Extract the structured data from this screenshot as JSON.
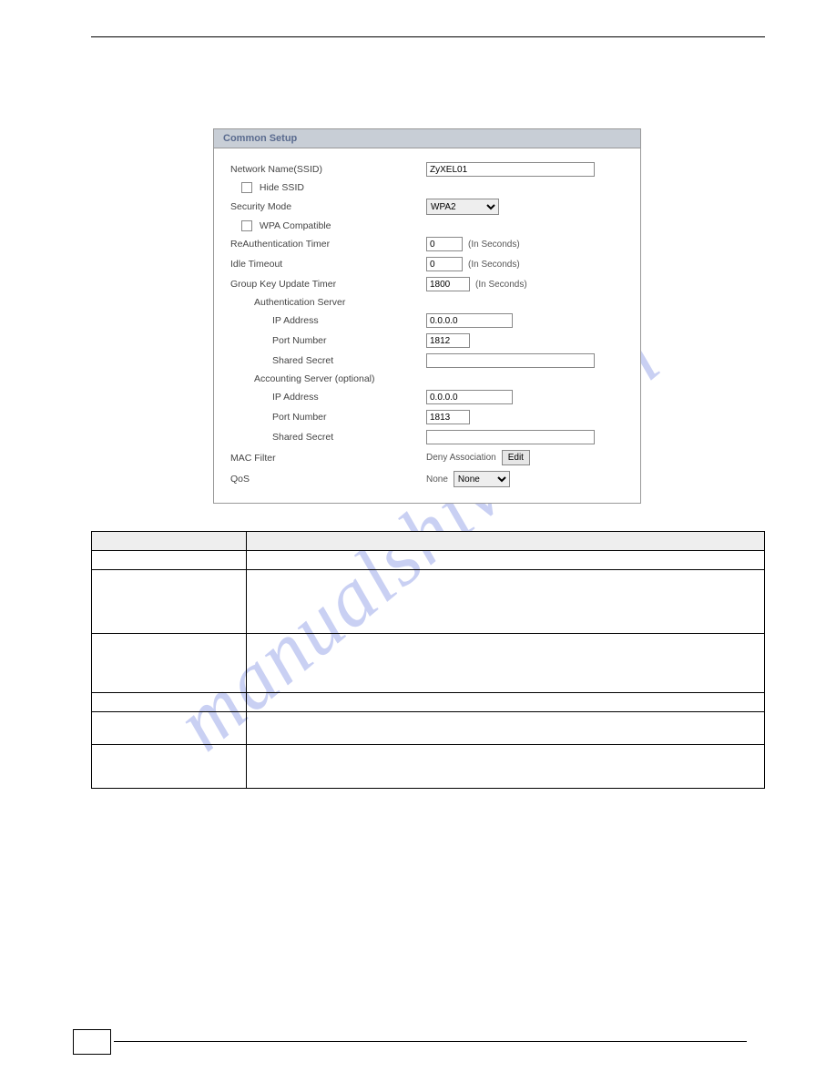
{
  "watermark": "manualshive.com",
  "panel": {
    "header": "Common Setup",
    "networkNameLabel": "Network Name(SSID)",
    "networkNameValue": "ZyXEL01",
    "hideSsid": "Hide SSID",
    "securityModeLabel": "Security Mode",
    "securityModeValue": "WPA2",
    "wpaCompat": "WPA Compatible",
    "reauthLabel": "ReAuthentication Timer",
    "reauthValue": "0",
    "reauthAfter": "(In Seconds)",
    "idleLabel": "Idle Timeout",
    "idleValue": "0",
    "idleAfter": "(In Seconds)",
    "groupKeyLabel": "Group Key Update Timer",
    "groupKeyValue": "1800",
    "groupKeyAfter": "(In Seconds)",
    "authServerLabel": "Authentication Server",
    "ipAddressLabel": "IP Address",
    "authIp": "0.0.0.0",
    "portLabel": "Port Number",
    "authPort": "1812",
    "sharedSecretLabel": "Shared Secret",
    "authSecret": "",
    "acctServerLabel": "Accounting Server (optional)",
    "acctIp": "0.0.0.0",
    "acctPort": "1813",
    "acctSecret": "",
    "macLabel": "MAC Filter",
    "macValue": "Deny Association",
    "editBtn": "Edit",
    "qosLabel": "QoS",
    "qosText": "None",
    "qosSelect": "None"
  },
  "table": {
    "h1": "",
    "h2": "",
    "r1c1": "",
    "r1c2": "",
    "r2c1": "",
    "r2c2": "",
    "r3c1": "",
    "r3c2": "",
    "r4c1": "",
    "r4c2": "",
    "r5c1": "",
    "r5c2": "",
    "r6c1": "",
    "r6c2": ""
  }
}
